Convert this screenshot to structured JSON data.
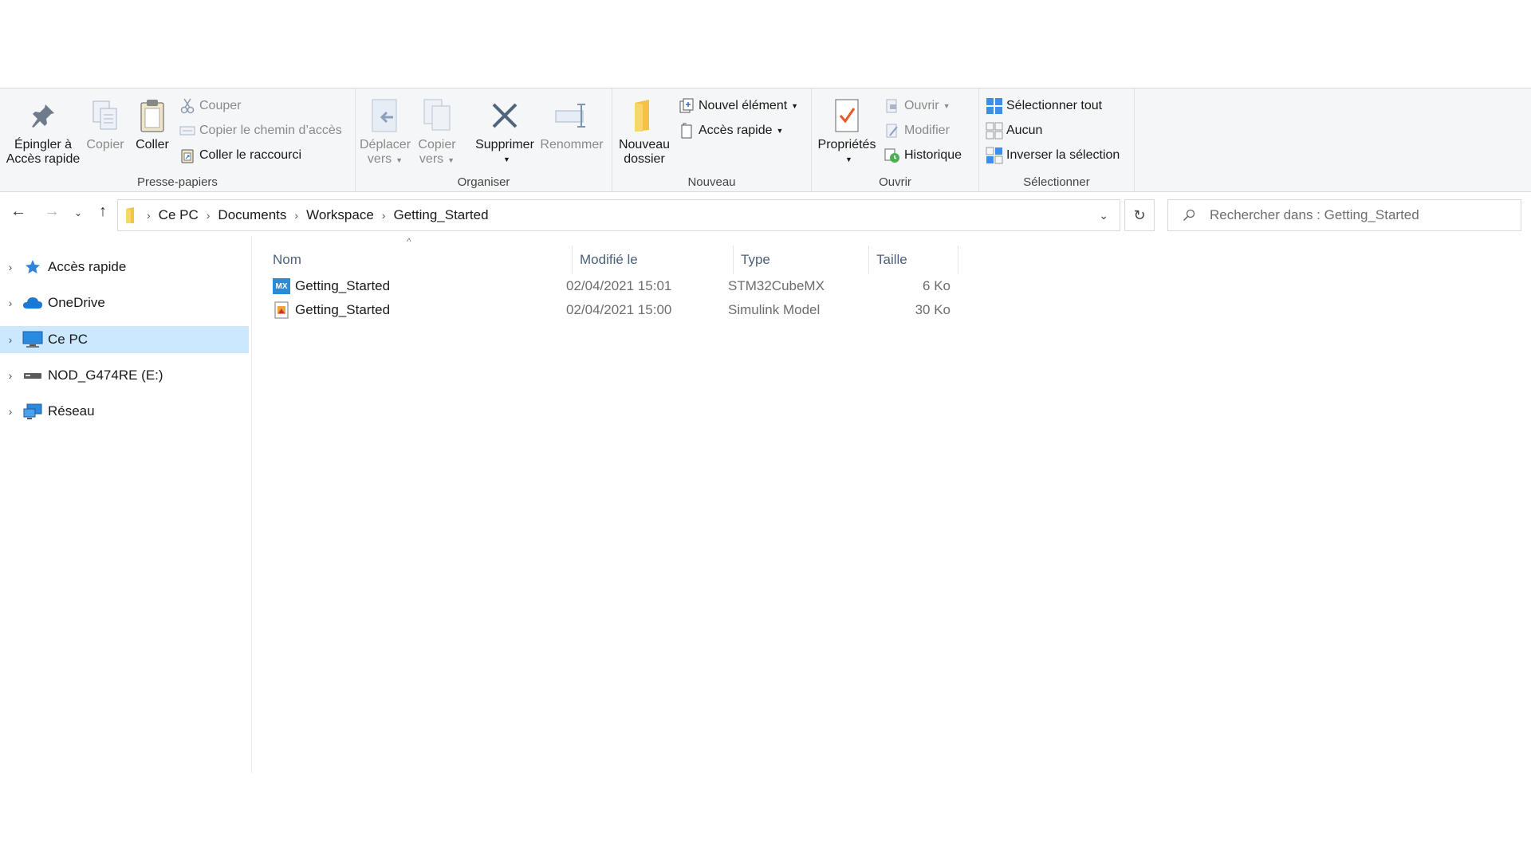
{
  "ribbon": {
    "presse_papiers": {
      "label": "Presse-papiers",
      "epingler_line1": "Épingler à",
      "epingler_line2": "Accès rapide",
      "copier": "Copier",
      "coller": "Coller",
      "couper": "Couper",
      "copier_chemin": "Copier le chemin d’accès",
      "coller_raccourci": "Coller le raccourci"
    },
    "organiser": {
      "label": "Organiser",
      "deplacer_line1": "Déplacer",
      "deplacer_line2": "vers",
      "copier_line1": "Copier",
      "copier_line2": "vers",
      "supprimer": "Supprimer",
      "renommer": "Renommer"
    },
    "nouveau": {
      "label": "Nouveau",
      "nouveau_dossier_line1": "Nouveau",
      "nouveau_dossier_line2": "dossier",
      "nouvel_element": "Nouvel élément",
      "acces_rapide": "Accès rapide"
    },
    "ouvrir": {
      "label": "Ouvrir",
      "proprietes": "Propriétés",
      "ouvrir": "Ouvrir",
      "modifier": "Modifier",
      "historique": "Historique"
    },
    "selectionner": {
      "label": "Sélectionner",
      "tout": "Sélectionner tout",
      "aucun": "Aucun",
      "inverser": "Inverser la sélection"
    }
  },
  "address": {
    "crumbs": [
      "Ce PC",
      "Documents",
      "Workspace",
      "Getting_Started"
    ]
  },
  "search": {
    "placeholder": "Rechercher dans : Getting_Started"
  },
  "nav": {
    "items": [
      {
        "label": "Accès rapide"
      },
      {
        "label": "OneDrive"
      },
      {
        "label": "Ce PC"
      },
      {
        "label": "NOD_G474RE (E:)"
      },
      {
        "label": "Réseau"
      }
    ]
  },
  "columns": {
    "name": "Nom",
    "modified": "Modifié le",
    "type": "Type",
    "size": "Taille"
  },
  "files": [
    {
      "name": "Getting_Started",
      "modified": "02/04/2021 15:01",
      "type": "STM32CubeMX",
      "size": "6 Ko",
      "icon_text": "MX"
    },
    {
      "name": "Getting_Started",
      "modified": "02/04/2021 15:00",
      "type": "Simulink Model",
      "size": "30 Ko"
    }
  ],
  "colors": {
    "selection": "#cce8ff",
    "accent": "#0078d7",
    "ribbon_bg": "#f5f6f7"
  }
}
